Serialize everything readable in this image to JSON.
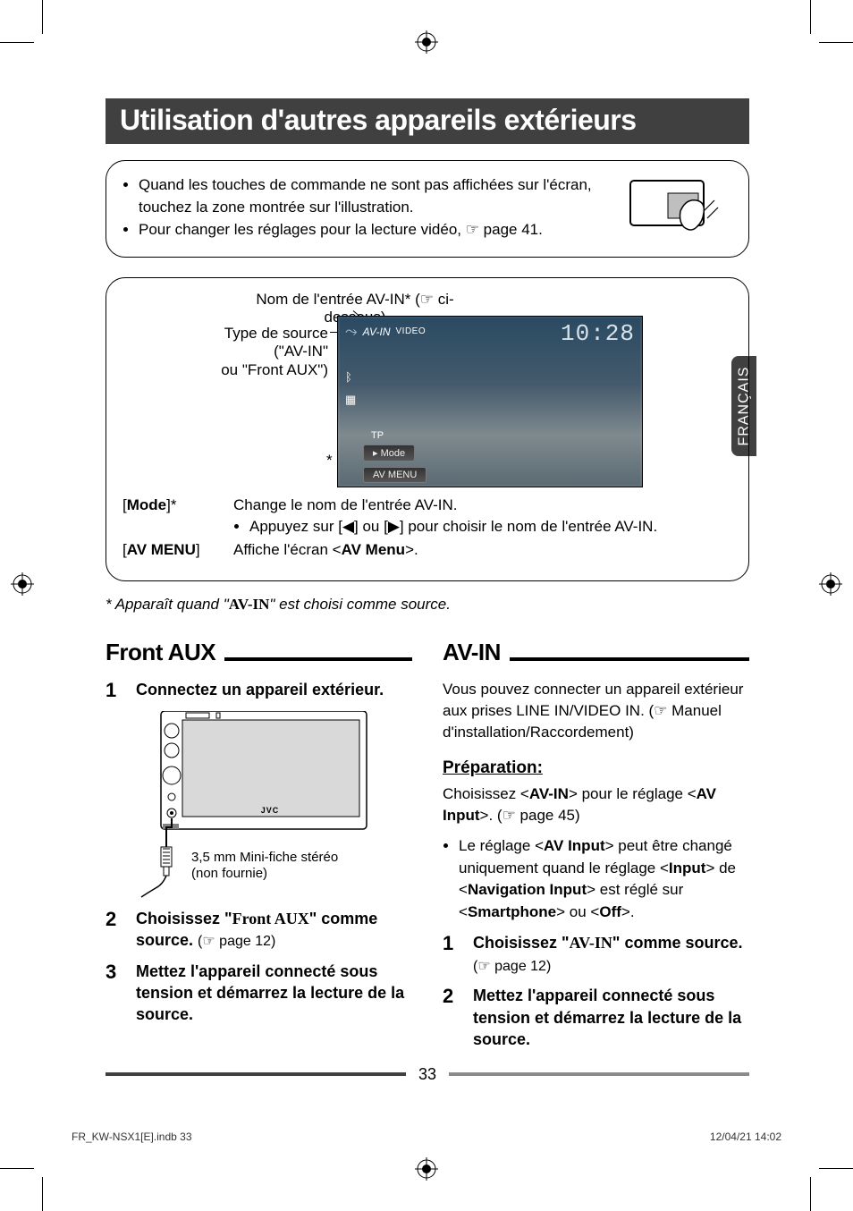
{
  "title": "Utilisation d'autres appareils extérieurs",
  "side_tab": "FRANÇAIS",
  "info_bullets": [
    "Quand les touches de commande ne sont pas affichées sur l'écran, touchez la zone montrée sur l'illustration.",
    "Pour changer les réglages pour la lecture vidéo, ☞ page 41."
  ],
  "diagram": {
    "label_name": "Nom de l'entrée AV-IN* (☞ ci-dessous)",
    "label_source_l1": "Type de source (\"AV-IN\"",
    "label_source_l2": "ou \"Front AUX\")",
    "asterisk": "*",
    "screen": {
      "src_type": "AV-IN",
      "video": "VIDEO",
      "clock": "10:28",
      "tp": "TP",
      "mode": "Mode",
      "avmenu": "AV MENU"
    },
    "rows": [
      {
        "key": "[Mode]*",
        "val": "Change le nom de l'entrée AV-IN.",
        "sub": "Appuyez sur [◀] ou [▶] pour choisir le nom de l'entrée AV-IN."
      },
      {
        "key": "[AV MENU]",
        "val_prefix": "Affiche l'écran <",
        "val_bold": "AV Menu",
        "val_suffix": ">."
      }
    ]
  },
  "footnote_prefix": "* Apparaît quand \"",
  "footnote_avin": "AV-IN",
  "footnote_suffix": "\" est choisi comme source.",
  "left": {
    "heading": "Front AUX",
    "step1": "Connectez un appareil extérieur.",
    "illus_label_l1": "3,5 mm Mini-fiche stéréo",
    "illus_label_l2": "(non fournie)",
    "illus_brand": "JVC",
    "step2_main": "Choisissez \"Front AUX\" comme source.",
    "step2_paren": "(☞ page 12)",
    "step3": "Mettez l'appareil connecté sous tension et démarrez la lecture de la source."
  },
  "right": {
    "heading": "AV-IN",
    "intro": "Vous pouvez connecter un appareil extérieur aux prises LINE IN/VIDEO IN. (☞ Manuel d'installation/Raccordement)",
    "prep_heading": "Préparation:",
    "prep_p_before": "Choisissez <",
    "prep_avin": "AV-IN",
    "prep_mid": "> pour le réglage <",
    "prep_avinput": "AV Input",
    "prep_after": ">. (☞ page 45)",
    "bul_before": "Le réglage <",
    "bul_avinput": "AV Input",
    "bul_mid1": "> peut être changé uniquement quand le réglage <",
    "bul_input": "Input",
    "bul_mid2": "> de <",
    "bul_nav": "Navigation Input",
    "bul_mid3": "> est réglé sur <",
    "bul_smart": "Smartphone",
    "bul_mid4": "> ou <",
    "bul_off": "Off",
    "bul_end": ">.",
    "step1_main": "Choisissez \"AV-IN\" comme source.",
    "step1_paren": "(☞ page 12)",
    "step2": "Mettez l'appareil connecté sous tension et démarrez la lecture de la source."
  },
  "page_number": "33",
  "tiny_left": "FR_KW-NSX1[E].indb   33",
  "tiny_right": "12/04/21   14:02"
}
